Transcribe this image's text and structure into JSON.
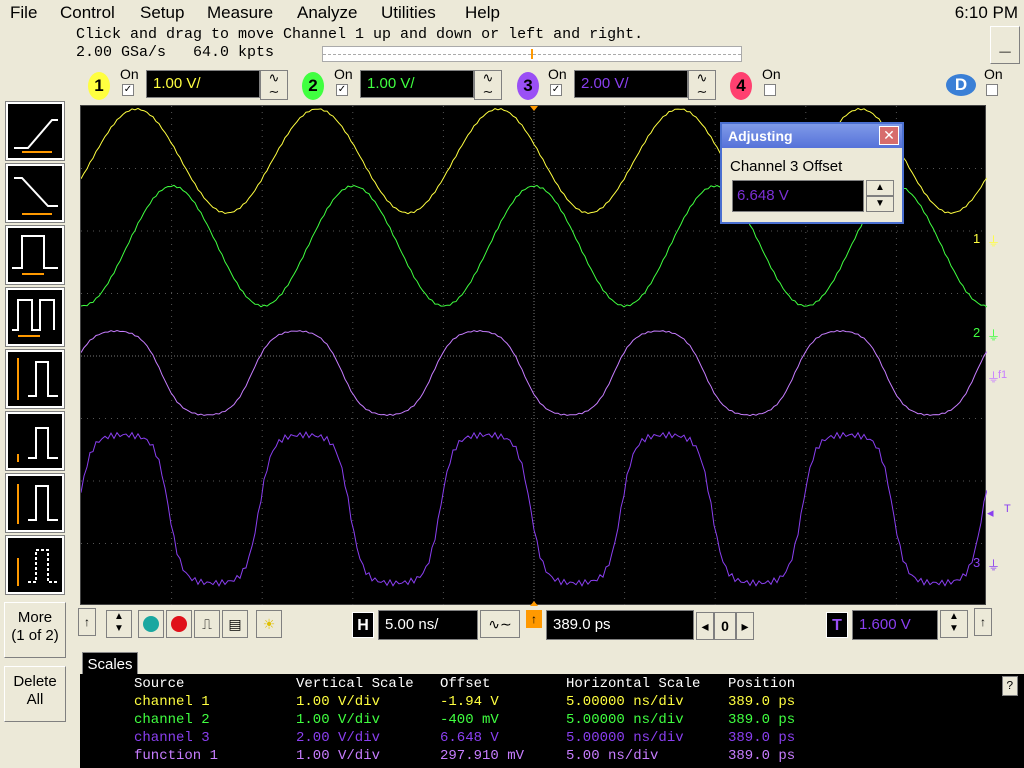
{
  "menu": {
    "items": [
      "File",
      "Control",
      "Setup",
      "Measure",
      "Analyze",
      "Utilities",
      "Help"
    ],
    "clock": "6:10 PM"
  },
  "status": {
    "message": "Click and drag to move Channel 1 up and down or left and right.",
    "sample_rate": "2.00 GSa/s",
    "memory": "64.0 kpts"
  },
  "channels": [
    {
      "num": "1",
      "on_label": "On",
      "checked": true,
      "scale": "1.00 V/",
      "color": "#ffff40"
    },
    {
      "num": "2",
      "on_label": "On",
      "checked": true,
      "scale": "1.00 V/",
      "color": "#40ff40"
    },
    {
      "num": "3",
      "on_label": "On",
      "checked": true,
      "scale": "2.00 V/",
      "color": "#8a3ff0"
    },
    {
      "num": "4",
      "on_label": "On",
      "checked": false,
      "color": "#ff4070"
    }
  ],
  "digital": {
    "label": "D",
    "on_label": "On"
  },
  "left_panel": {
    "more_label": "More",
    "more_page": "(1 of 2)",
    "delete_label": "Delete",
    "delete_sub": "All"
  },
  "dialog": {
    "title": "Adjusting",
    "label": "Channel 3 Offset",
    "value": "6.648 V"
  },
  "markers": {
    "ch1": "1",
    "ch2": "2",
    "ch3": "3",
    "f1": "f1",
    "t": "T"
  },
  "timebase": {
    "h_label": "H",
    "scale": "5.00 ns/",
    "position": "389.0 ps",
    "zero": "0",
    "trigger_label": "T",
    "trigger_level": "1.600 V"
  },
  "tabs": {
    "scales": "Scales"
  },
  "help_label": "?",
  "table": {
    "headers": [
      "Source",
      "Vertical Scale",
      "Offset",
      "Horizontal Scale",
      "Position"
    ],
    "rows": [
      {
        "source": "channel 1",
        "vscale": "1.00 V/div",
        "offset": "-1.94 V",
        "hscale": "5.00000 ns/div",
        "pos": "389.0 ps",
        "color": "#ffff40"
      },
      {
        "source": "channel 2",
        "vscale": "1.00 V/div",
        "offset": "-400 mV",
        "hscale": "5.00000 ns/div",
        "pos": "389.0 ps",
        "color": "#40ff40"
      },
      {
        "source": "channel 3",
        "vscale": "2.00 V/div",
        "offset": "6.648 V",
        "hscale": "5.00000 ns/div",
        "pos": "389.0 ps",
        "color": "#8a3ff0"
      },
      {
        "source": "function 1",
        "vscale": "1.00 V/div",
        "offset": "297.910 mV",
        "hscale": "5.00 ns/div",
        "pos": "389.0 ps",
        "color": "#c77dff"
      }
    ]
  }
}
